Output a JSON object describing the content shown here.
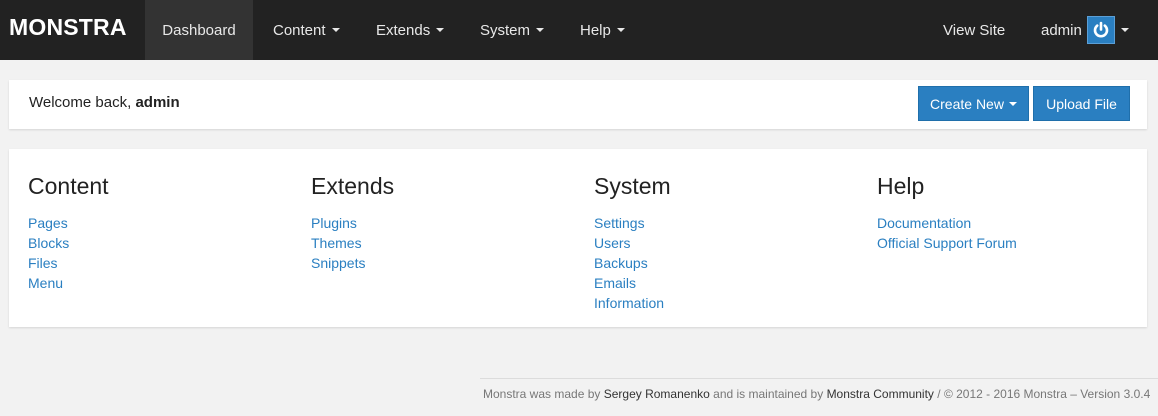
{
  "brand": "MONSTRA",
  "nav": {
    "dashboard": "Dashboard",
    "content": "Content",
    "extends": "Extends",
    "system": "System",
    "help": "Help",
    "view_site": "View Site",
    "user": "admin"
  },
  "welcome": {
    "prefix": "Welcome back,",
    "user": "admin",
    "create_new": "Create New",
    "upload_file": "Upload File"
  },
  "sections": {
    "content": {
      "title": "Content",
      "links": [
        "Pages",
        "Blocks",
        "Files",
        "Menu"
      ]
    },
    "extends": {
      "title": "Extends",
      "links": [
        "Plugins",
        "Themes",
        "Snippets"
      ]
    },
    "system": {
      "title": "System",
      "links": [
        "Settings",
        "Users",
        "Backups",
        "Emails",
        "Information"
      ]
    },
    "help": {
      "title": "Help",
      "links": [
        "Documentation",
        "Official Support Forum"
      ]
    }
  },
  "footer": {
    "made_by": "Monstra was made by",
    "author": "Sergey Romanenko",
    "maintained": "and is maintained by",
    "community": "Monstra Community",
    "copyright": "/ © 2012 - 2016 Monstra – Version 3.0.4"
  },
  "colors": {
    "navbar": "#222222",
    "accent": "#2a7fc1",
    "background": "#f2f2f2"
  },
  "icons": {
    "user_menu": "power-icon",
    "dropdown": "caret-down-icon"
  }
}
